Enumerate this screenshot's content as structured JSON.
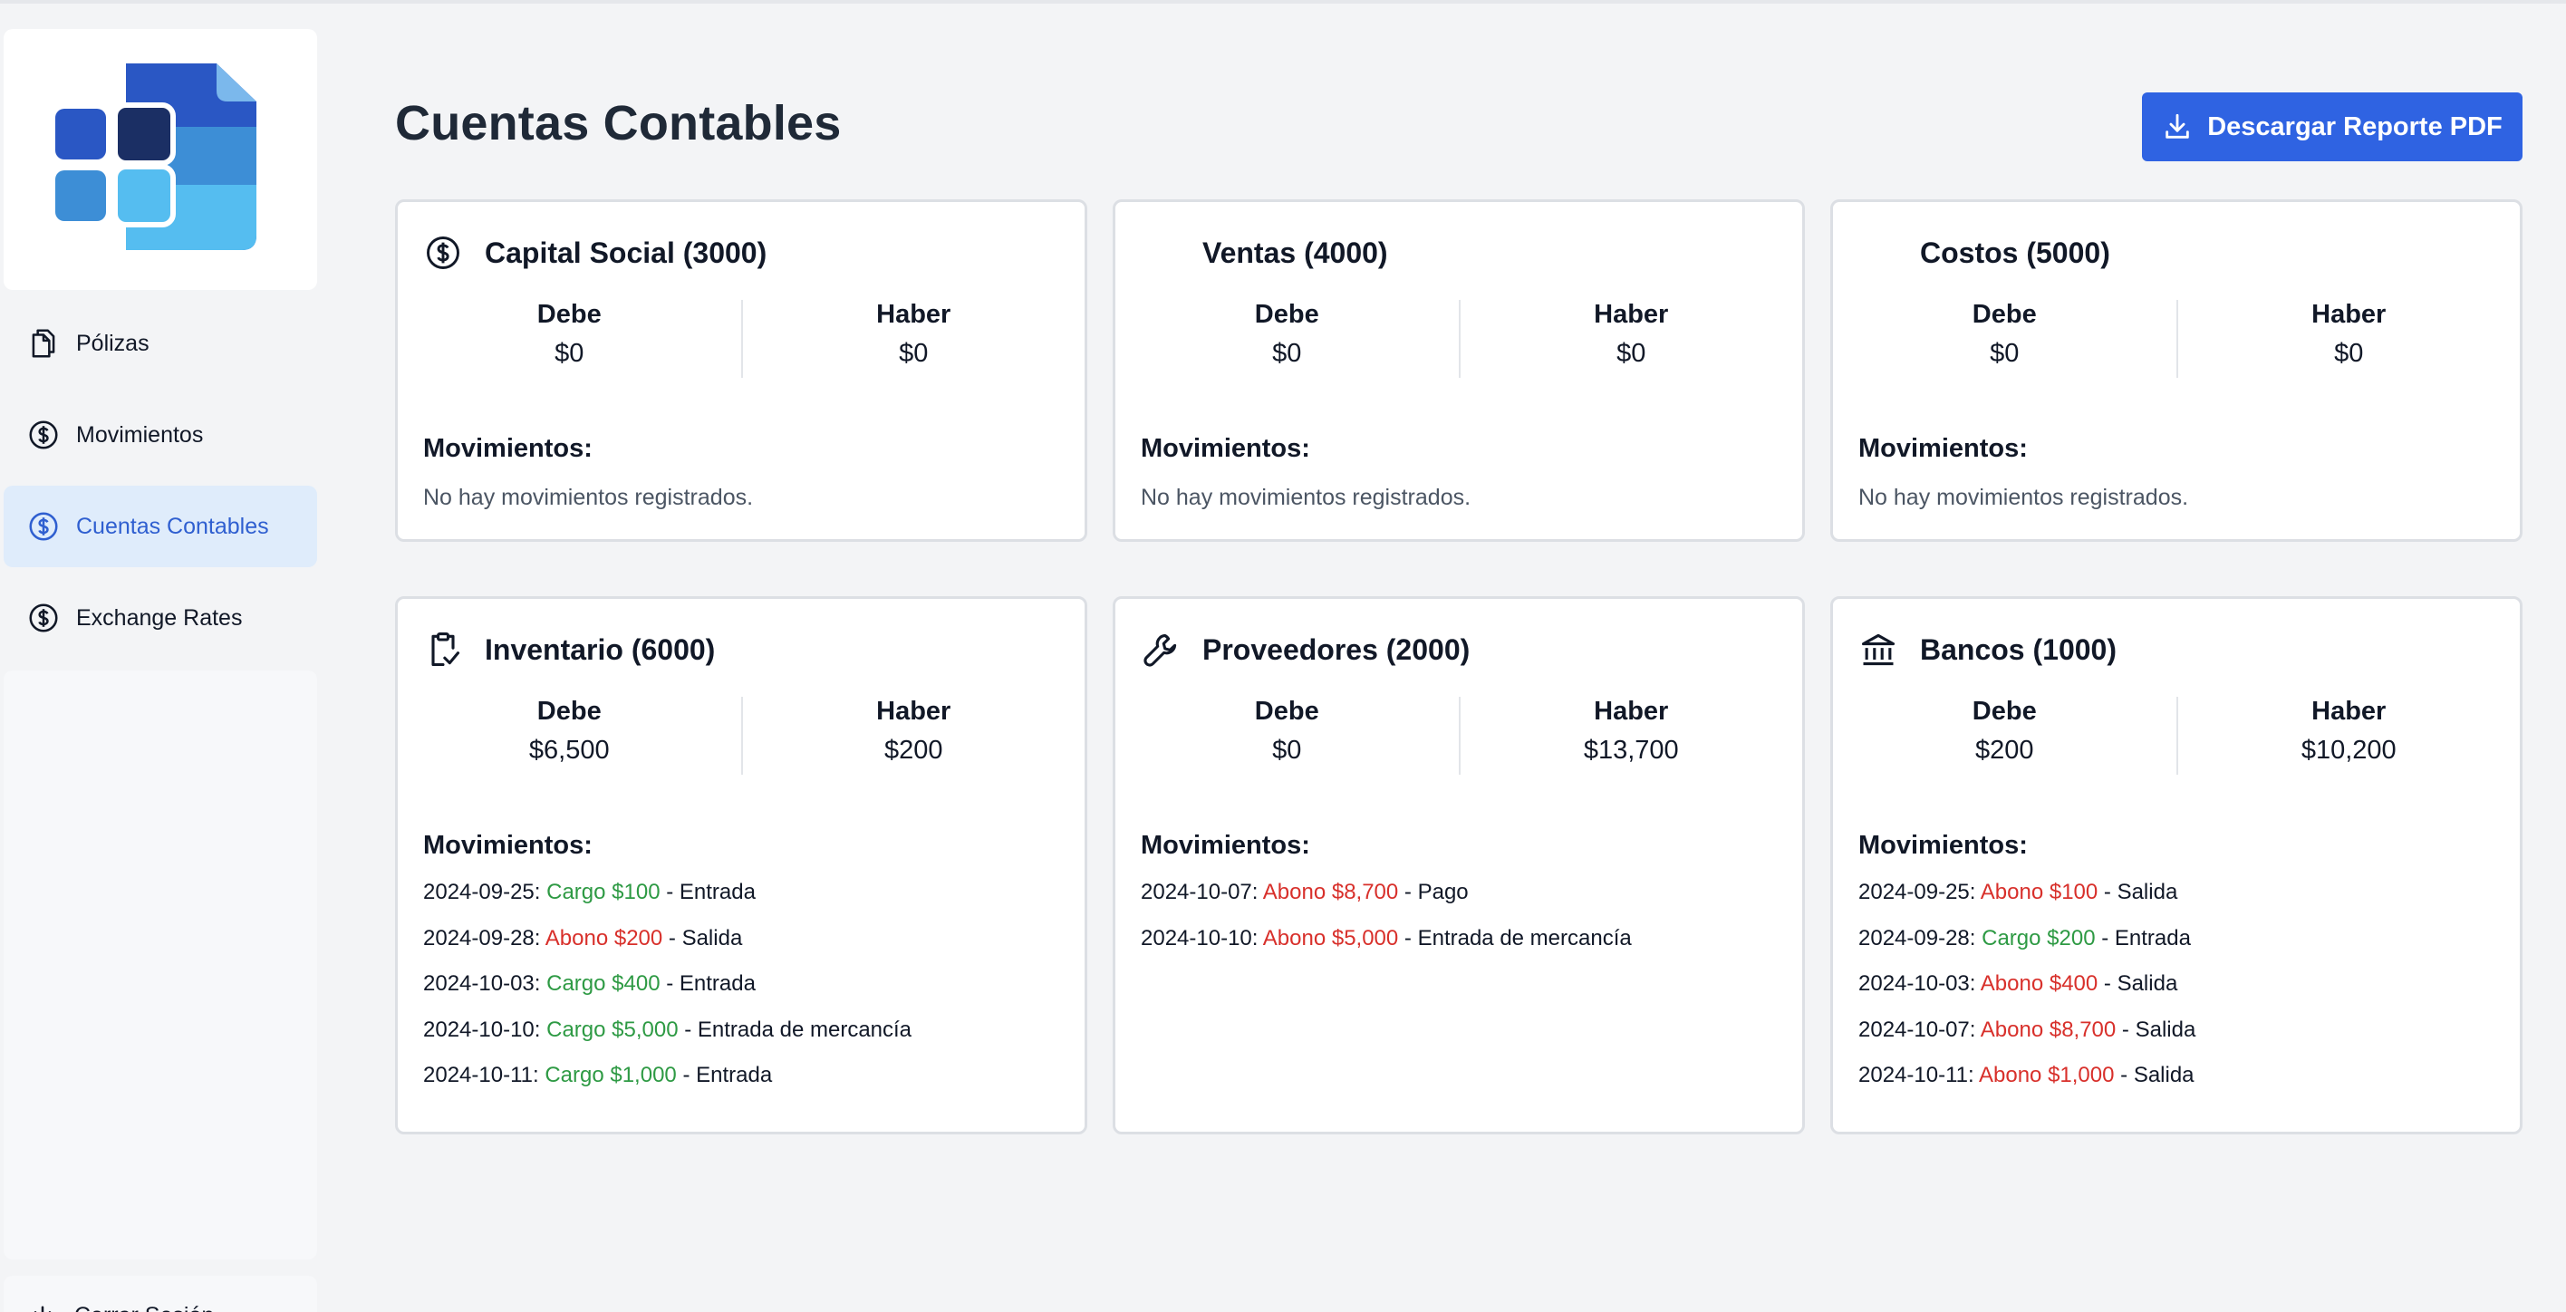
{
  "sidebar": {
    "items": [
      {
        "label": "Pólizas",
        "icon": "documents-icon"
      },
      {
        "label": "Movimientos",
        "icon": "dollar-circle-icon"
      },
      {
        "label": "Cuentas Contables",
        "icon": "dollar-circle-icon",
        "active": true
      },
      {
        "label": "Exchange Rates",
        "icon": "dollar-circle-icon"
      }
    ],
    "logout_label": "Cerrar Sesión"
  },
  "page": {
    "title": "Cuentas Contables",
    "download_label": "Descargar Reporte PDF"
  },
  "labels": {
    "debe": "Debe",
    "haber": "Haber",
    "movimientos": "Movimientos:",
    "empty": "No hay movimientos registrados."
  },
  "colors": {
    "accent": "#2f63e2",
    "cargo": "#2e9a44",
    "abono": "#d8302b",
    "active_nav_bg": "#dfecfb"
  },
  "cards": [
    {
      "title": "Capital Social (3000)",
      "icon": "dollar-circle-icon",
      "debe": "$0",
      "haber": "$0",
      "movements": []
    },
    {
      "title": "Ventas (4000)",
      "icon": "",
      "debe": "$0",
      "haber": "$0",
      "movements": []
    },
    {
      "title": "Costos (5000)",
      "icon": "",
      "debe": "$0",
      "haber": "$0",
      "movements": []
    },
    {
      "title": "Inventario (6000)",
      "icon": "clipboard-check-icon",
      "debe": "$6,500",
      "haber": "$200",
      "movements": [
        {
          "date": "2024-09-25:",
          "amount": "Cargo $100",
          "kind": "cargo",
          "desc": " - Entrada"
        },
        {
          "date": "2024-09-28:",
          "amount": "Abono $200",
          "kind": "abono",
          "desc": " - Salida"
        },
        {
          "date": "2024-10-03:",
          "amount": "Cargo $400",
          "kind": "cargo",
          "desc": " - Entrada"
        },
        {
          "date": "2024-10-10:",
          "amount": "Cargo $5,000",
          "kind": "cargo",
          "desc": " - Entrada de mercancía"
        },
        {
          "date": "2024-10-11:",
          "amount": "Cargo $1,000",
          "kind": "cargo",
          "desc": " - Entrada"
        }
      ]
    },
    {
      "title": "Proveedores (2000)",
      "icon": "wrench-icon",
      "debe": "$0",
      "haber": "$13,700",
      "movements": [
        {
          "date": "2024-10-07:",
          "amount": "Abono $8,700",
          "kind": "abono",
          "desc": " - Pago"
        },
        {
          "date": "2024-10-10:",
          "amount": "Abono $5,000",
          "kind": "abono",
          "desc": " - Entrada de mercancía"
        }
      ]
    },
    {
      "title": "Bancos (1000)",
      "icon": "bank-icon",
      "debe": "$200",
      "haber": "$10,200",
      "movements": [
        {
          "date": "2024-09-25:",
          "amount": "Abono $100",
          "kind": "abono",
          "desc": " - Salida"
        },
        {
          "date": "2024-09-28:",
          "amount": "Cargo $200",
          "kind": "cargo",
          "desc": " - Entrada"
        },
        {
          "date": "2024-10-03:",
          "amount": "Abono $400",
          "kind": "abono",
          "desc": " - Salida"
        },
        {
          "date": "2024-10-07:",
          "amount": "Abono $8,700",
          "kind": "abono",
          "desc": " - Salida"
        },
        {
          "date": "2024-10-11:",
          "amount": "Abono $1,000",
          "kind": "abono",
          "desc": " - Salida"
        }
      ]
    }
  ]
}
